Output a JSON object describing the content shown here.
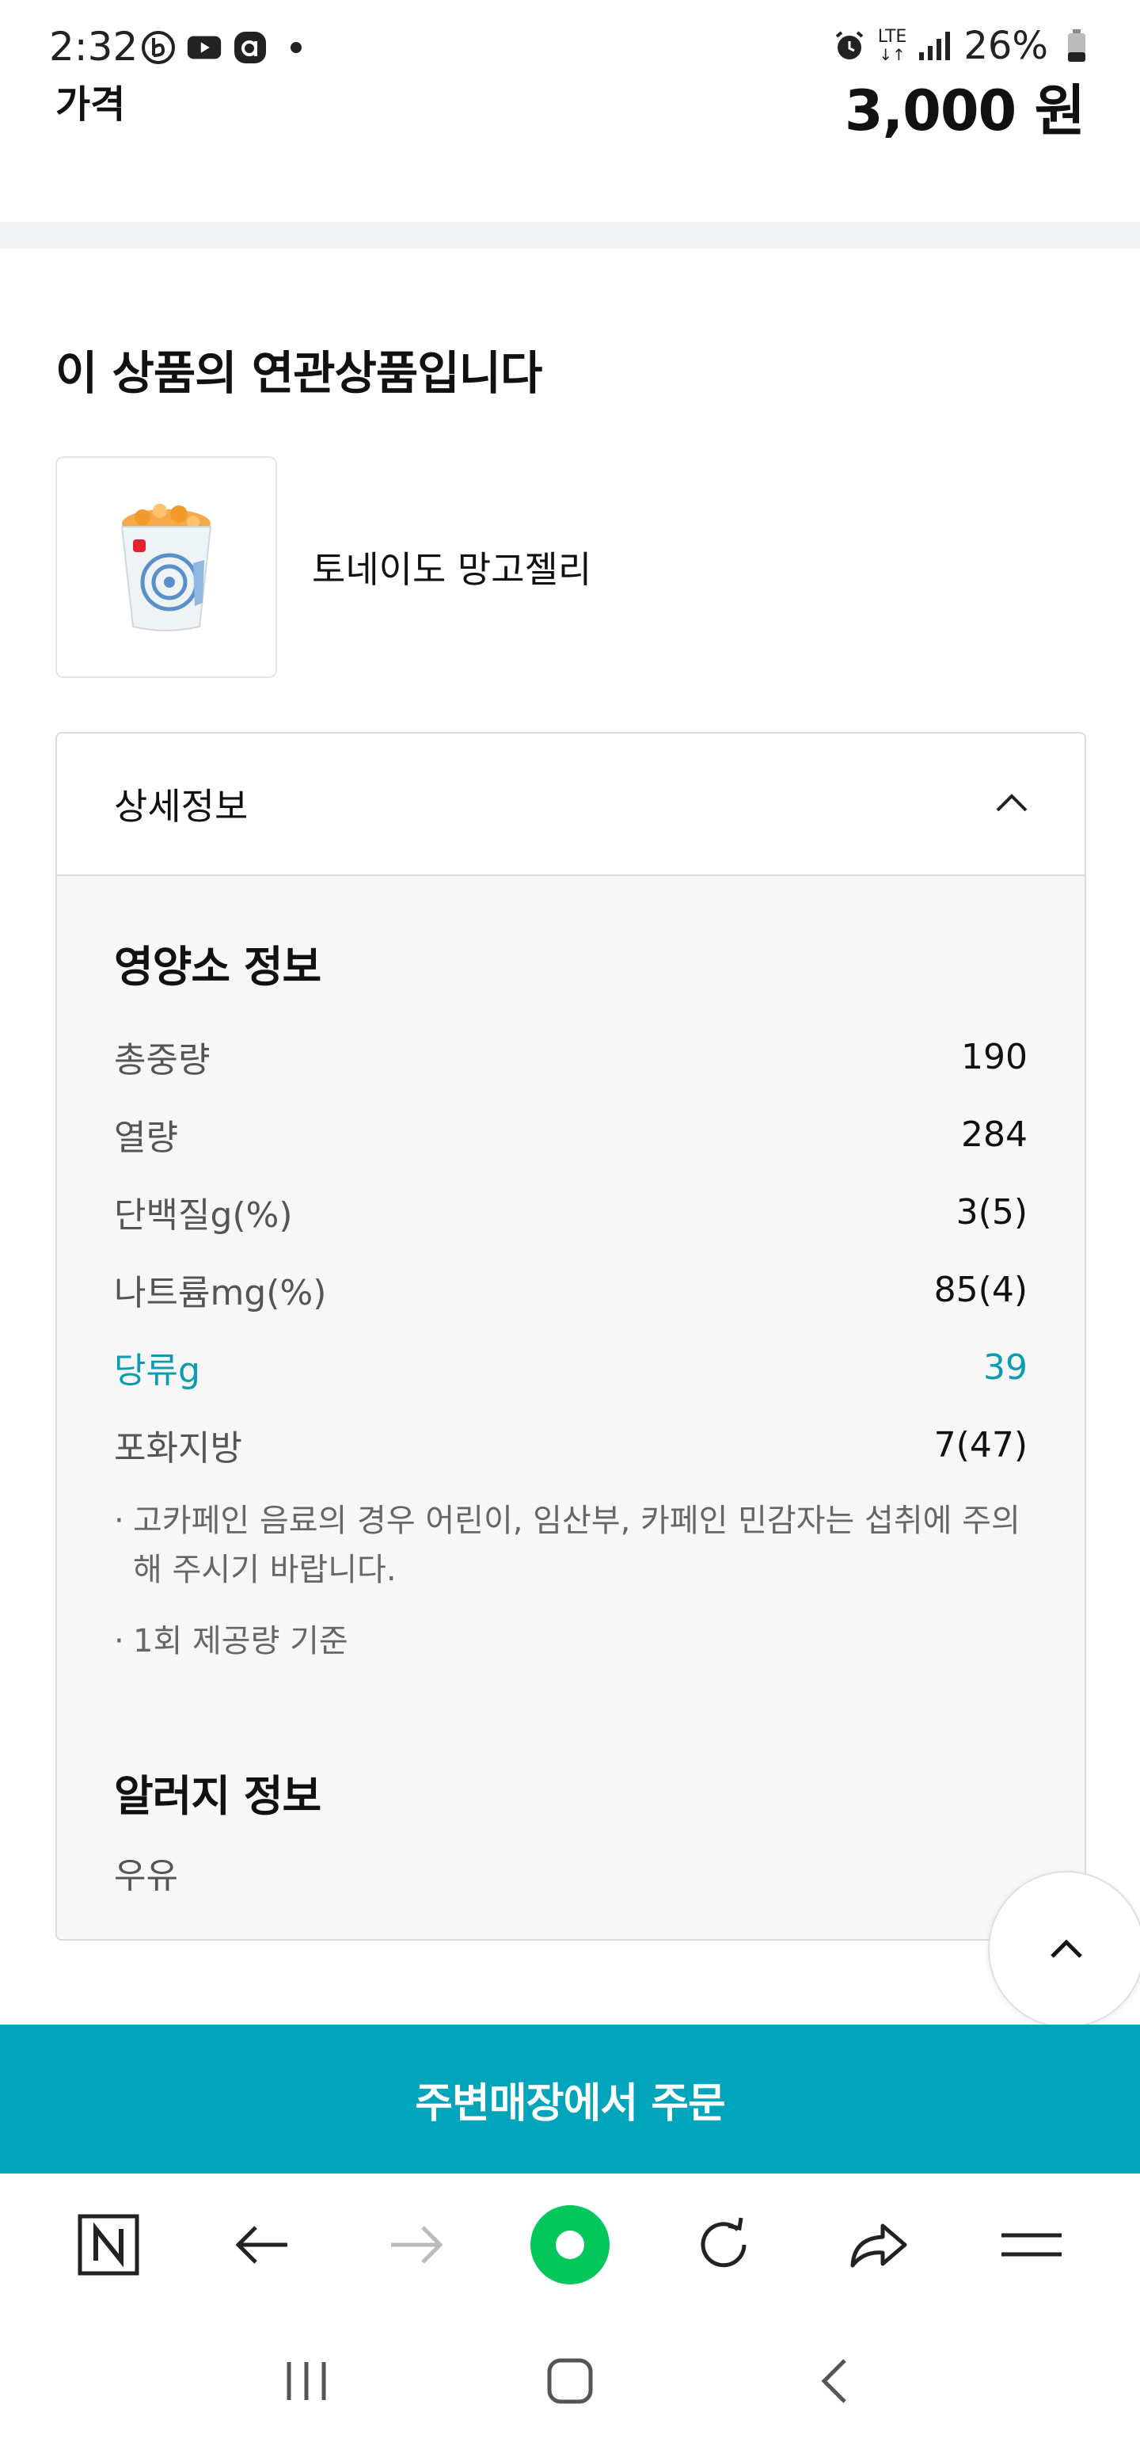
{
  "status_bar": {
    "time": "2:32",
    "battery": "26%",
    "network": "LTE",
    "icons": [
      "b-app-icon",
      "youtube-icon",
      "a-app-icon",
      "dot-icon",
      "alarm-icon",
      "lte-icon",
      "signal-icon",
      "battery-icon"
    ]
  },
  "price": {
    "label": "가격",
    "value": "3,000 원"
  },
  "related": {
    "title": "이 상품의 연관상품입니다",
    "items": [
      {
        "name": "토네이도 망고젤리",
        "image": "mango-jelly-cup"
      }
    ]
  },
  "detail": {
    "header_title": "상세정보",
    "nutrition": {
      "title": "영양소 정보",
      "rows": [
        {
          "key": "총중량",
          "value": "190"
        },
        {
          "key": "열량",
          "value": "284"
        },
        {
          "key": "단백질g(%)",
          "value": "3(5)"
        },
        {
          "key": "나트륨mg(%)",
          "value": "85(4)"
        },
        {
          "key": "당류g",
          "value": "39"
        },
        {
          "key": "포화지방",
          "value": "7(47)"
        }
      ],
      "notes": [
        "고카페인 음료의 경우 어린이, 임산부, 카페인 민감자는 섭취에 주의해 주시기 바랍니다.",
        "1회 제공량 기준"
      ]
    },
    "allergy": {
      "title": "알러지 정보",
      "value": "우유"
    }
  },
  "order_button": {
    "label": "주변매장에서 주문"
  },
  "colors": {
    "accent": "#00a5bb",
    "highlight_text": "#0a9cb3",
    "browser_green": "#03c75a"
  },
  "browser_bar": {
    "icons": [
      "naver-n-icon",
      "back-arrow-icon",
      "forward-arrow-icon",
      "green-home-icon",
      "refresh-icon",
      "share-icon",
      "menu-icon"
    ]
  },
  "system_nav": {
    "icons": [
      "recent-apps-icon",
      "home-icon",
      "back-icon"
    ]
  }
}
